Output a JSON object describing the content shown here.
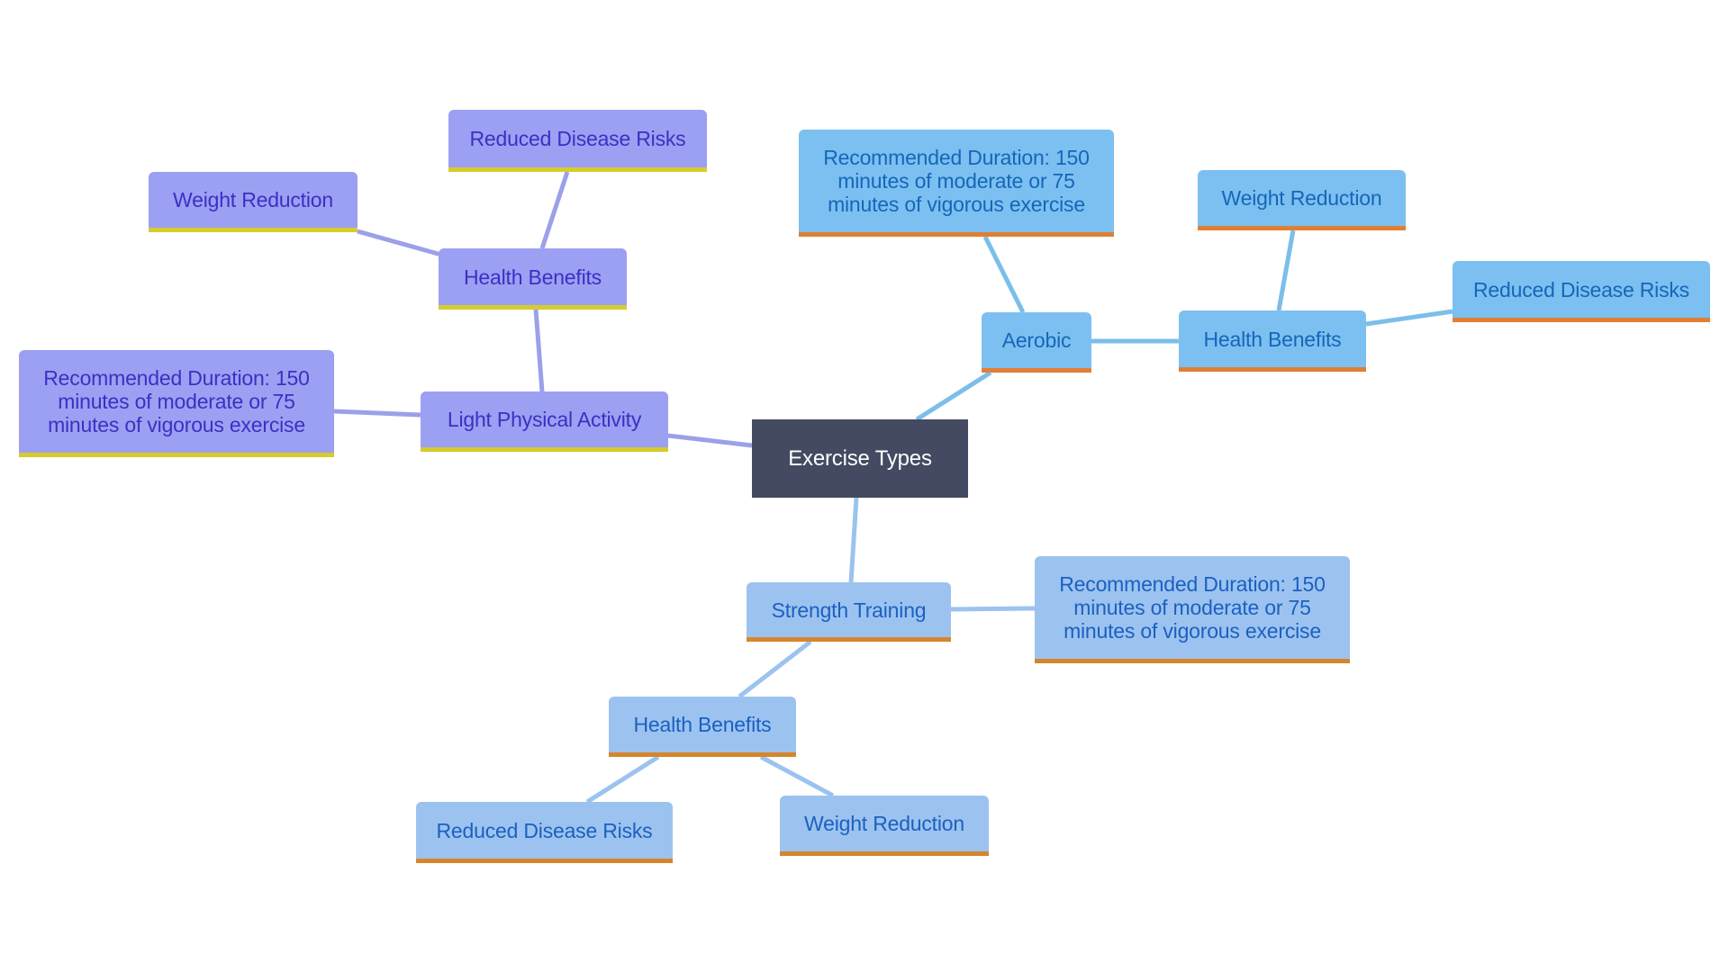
{
  "root": {
    "label": "Exercise Types"
  },
  "branches": {
    "light": {
      "label": "Light Physical Activity",
      "duration": "Recommended Duration: 150 minutes of moderate or 75 minutes of vigorous exercise",
      "health_benefits": {
        "label": "Health Benefits",
        "children": [
          "Weight Reduction",
          "Reduced Disease Risks"
        ]
      }
    },
    "aerobic": {
      "label": "Aerobic",
      "duration": "Recommended Duration: 150 minutes of moderate or 75 minutes of vigorous exercise",
      "health_benefits": {
        "label": "Health Benefits",
        "children": [
          "Weight Reduction",
          "Reduced Disease Risks"
        ]
      }
    },
    "strength": {
      "label": "Strength Training",
      "duration": "Recommended Duration: 150 minutes of moderate or 75 minutes of vigorous exercise",
      "health_benefits": {
        "label": "Health Benefits",
        "children": [
          "Reduced Disease Risks",
          "Weight Reduction"
        ]
      }
    }
  },
  "colors": {
    "root": "#434a61",
    "light": "#9ca0f2",
    "aerobic": "#7cc0f1",
    "strength": "#9cc3ef"
  }
}
